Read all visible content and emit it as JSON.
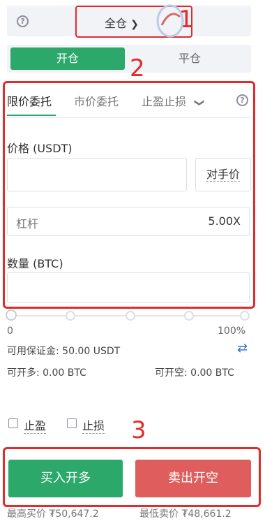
{
  "header": {
    "margin_mode": "全仓",
    "annotation": "1"
  },
  "position_toggle": {
    "open_label": "开仓",
    "close_label": "平仓",
    "annotation": "2"
  },
  "order_tabs": {
    "items": [
      "限价委托",
      "市价委托",
      "止盈止损"
    ],
    "active": "限价委托"
  },
  "form": {
    "price_label": "价格 (USDT)",
    "counterparty_label": "对手价",
    "leverage_label": "杠杆",
    "leverage_value": "5.00X",
    "quantity_label": "数量 (BTC)"
  },
  "slider": {
    "min_label": "0",
    "max_label": "100%",
    "value_fraction": 0
  },
  "account": {
    "available_margin": "可用保证金: 50.00 USDT",
    "can_open_long": "可开多: 0.00 BTC",
    "can_open_short": "可开空: 0.00 BTC"
  },
  "options": {
    "take_profit_label": "止盈",
    "stop_loss_label": "止损",
    "annotation": "3"
  },
  "actions": {
    "buy_label": "买入开多",
    "sell_label": "卖出开空"
  },
  "prices": {
    "best_bid": "最高买价 ₮50,647.2",
    "best_ask": "最低卖价 ₮48,661.2"
  },
  "colors": {
    "accent_green": "#2ba86a",
    "accent_red": "#e05d5d",
    "annotation_red": "#e22b2b"
  }
}
